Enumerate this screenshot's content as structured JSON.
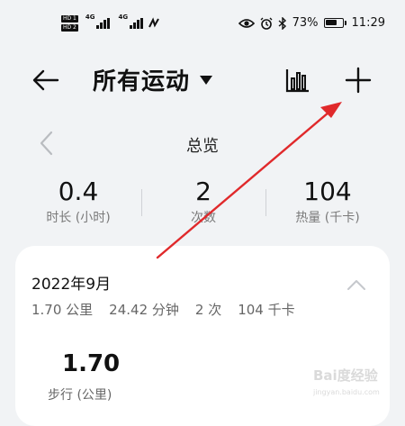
{
  "status_bar": {
    "sim_badges": [
      "HD 1",
      "HD 2"
    ],
    "net_badges": [
      "4G",
      "4G"
    ],
    "battery_percent": "73%",
    "battery_level": 0.73,
    "time": "11:29"
  },
  "header": {
    "title": "所有运动"
  },
  "overview": {
    "title": "总览",
    "stats": [
      {
        "value": "0.4",
        "label": "时长 (小时)"
      },
      {
        "value": "2",
        "label": "次数"
      },
      {
        "value": "104",
        "label": "热量 (千卡)"
      }
    ]
  },
  "month_card": {
    "month": "2022年9月",
    "distance": "1.70 公里",
    "duration": "24.42 分钟",
    "count": "2 次",
    "calories": "104 千卡",
    "walk_value": "1.70",
    "walk_label": "步行 (公里)"
  },
  "colors": {
    "background": "#f1f3f5",
    "card": "#ffffff",
    "annotation_arrow": "#e0292b"
  },
  "watermark": {
    "text": "Bai度经验"
  }
}
